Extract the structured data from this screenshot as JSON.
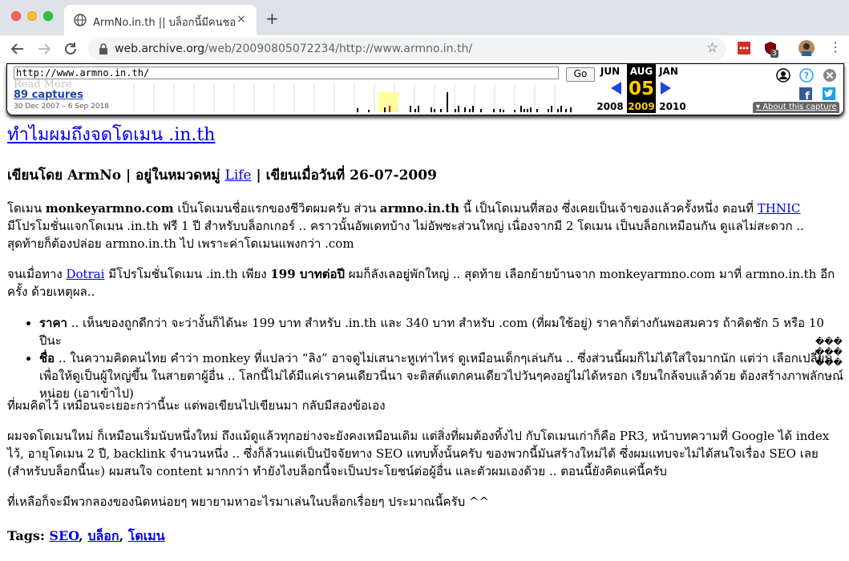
{
  "browser": {
    "tab_title": "ArmNo.in.th || บล็อกนี้มีคนชอบดู",
    "tab_close": "×",
    "new_tab": "+",
    "url_domain": "web.archive.org",
    "url_path": "/web/20090805072234/http://www.armno.in.th/",
    "ext_badge": "3"
  },
  "wayback": {
    "url_value": "http://www.armno.in.th/",
    "go_label": "Go",
    "read_more": "Read More",
    "captures": "89 captures",
    "range": "30 Dec 2007 – 6 Sep 2018",
    "prev_month": "JUN",
    "cur_month": "AUG",
    "next_month": "JAN",
    "cur_day": "05",
    "prev_year": "2008",
    "cur_year": "2009",
    "next_year": "2010",
    "about": "About this capture",
    "sparkline": [
      0,
      0,
      0,
      0,
      0,
      0,
      0,
      0,
      0,
      0,
      0,
      0,
      0,
      0,
      0,
      0,
      0,
      0,
      0,
      0,
      0,
      0,
      0,
      0,
      0,
      0,
      0,
      0,
      0,
      0,
      0,
      0,
      0,
      0,
      0,
      0,
      0,
      0,
      0,
      0,
      0,
      0,
      0,
      0,
      0,
      0,
      0,
      0,
      0,
      0,
      0,
      0,
      0,
      0,
      0,
      0,
      0,
      0,
      0,
      0,
      0,
      0,
      0,
      0,
      0,
      0,
      0,
      0,
      0,
      0,
      0,
      0,
      0,
      0,
      0,
      0,
      0,
      0,
      0,
      0,
      0,
      0,
      0,
      0,
      0,
      0,
      0,
      0,
      0,
      0,
      0,
      0,
      0,
      0,
      0,
      0,
      0,
      0,
      0,
      0,
      0,
      0,
      0,
      0,
      0,
      0,
      0,
      0,
      0,
      0,
      0,
      0,
      0,
      0,
      0,
      0,
      0,
      0,
      0,
      0,
      0,
      0,
      0,
      0,
      0,
      0,
      0,
      0,
      0,
      0,
      0,
      0,
      0,
      0,
      0,
      0,
      0,
      0,
      0,
      0,
      0,
      0,
      0,
      0,
      0,
      0,
      0,
      0,
      0,
      0,
      0,
      0,
      0,
      0,
      0,
      0,
      0,
      0,
      0,
      0,
      0,
      0,
      0,
      0,
      0,
      0,
      0,
      0,
      0,
      0,
      0,
      0,
      0,
      0,
      0,
      0,
      0,
      0,
      0,
      0,
      0,
      0,
      0,
      0,
      0,
      0,
      0,
      0,
      0,
      0,
      0,
      0,
      0,
      0,
      0,
      0,
      0,
      0,
      0,
      0,
      0,
      0,
      0,
      0,
      0,
      0,
      0,
      0,
      0,
      0,
      0,
      0,
      0,
      0,
      0,
      0,
      0,
      0,
      0,
      0,
      0,
      0,
      0,
      0,
      0,
      0,
      0,
      0,
      0,
      0,
      0,
      0,
      0,
      0,
      0,
      0,
      0,
      0,
      0,
      0,
      0,
      0,
      0,
      0,
      0,
      0,
      0,
      0,
      0,
      0,
      0,
      0,
      0,
      0,
      0,
      0,
      0,
      0,
      0,
      0,
      0,
      0,
      0,
      0,
      0,
      0,
      0,
      0,
      0,
      0,
      0,
      0,
      0,
      0,
      0,
      0,
      0,
      0,
      0,
      0,
      0,
      0,
      0,
      0,
      0,
      0,
      0,
      0,
      0,
      0,
      0,
      0,
      0,
      0,
      0,
      0,
      0,
      0,
      0,
      0,
      0,
      0,
      0,
      0,
      0,
      0,
      0,
      0,
      0,
      0,
      0,
      0,
      0,
      0,
      0,
      0,
      0,
      0,
      0,
      0,
      0,
      0,
      0,
      0,
      0,
      0,
      0,
      0,
      0,
      0,
      0,
      0,
      0,
      0,
      0,
      0,
      0,
      0,
      0,
      0,
      0,
      0,
      0,
      0,
      0,
      0,
      0,
      0,
      0,
      0,
      0,
      0,
      0,
      0,
      0,
      0,
      0,
      0,
      0,
      0,
      0,
      0,
      0,
      0,
      0,
      0,
      0,
      0,
      0,
      0,
      0,
      0,
      0,
      0,
      0,
      0,
      0,
      0,
      0,
      0,
      0,
      0,
      0,
      0,
      0,
      0,
      0,
      0,
      0,
      0,
      0,
      0,
      0,
      0,
      0,
      0,
      0,
      0,
      0,
      0,
      0,
      0,
      0,
      0,
      0,
      0,
      0,
      0,
      0,
      0,
      0,
      0,
      0,
      0,
      0,
      0,
      0,
      0,
      0,
      0,
      0,
      0,
      0,
      0,
      0,
      0,
      0,
      0,
      0,
      0,
      0,
      0,
      0,
      0,
      0,
      0,
      0,
      0,
      0,
      0,
      0,
      0,
      0,
      0,
      0,
      0,
      0,
      0,
      0,
      0,
      0,
      0,
      0,
      0,
      0,
      0,
      0,
      0,
      0,
      0,
      0,
      0,
      0,
      0,
      0,
      0,
      0,
      0,
      0,
      0,
      0,
      0,
      0,
      0,
      0,
      0,
      0,
      0,
      0,
      0,
      0,
      0,
      0,
      0,
      0,
      0,
      0,
      0,
      0,
      0,
      0,
      0,
      0,
      0,
      0,
      0,
      0,
      0,
      0,
      0,
      0,
      0,
      0,
      0,
      0,
      0,
      0,
      0,
      0,
      0,
      0,
      0,
      0,
      0,
      0,
      0,
      0,
      0,
      0,
      0,
      0,
      0,
      0,
      0,
      0,
      0,
      0,
      0,
      0,
      0,
      0,
      0,
      0,
      0,
      0,
      0,
      0,
      0,
      0,
      0,
      0,
      0,
      0,
      0,
      0,
      0,
      0,
      0,
      0,
      0,
      0,
      0,
      0,
      0,
      0,
      0,
      0,
      0,
      0,
      0,
      0,
      0,
      0,
      0,
      0,
      0,
      0,
      0,
      0,
      0,
      0,
      0,
      0,
      0,
      0,
      0,
      0,
      0,
      0,
      0,
      0,
      0,
      0,
      0,
      0,
      0,
      0,
      0,
      0,
      0,
      0,
      0,
      0,
      0,
      0,
      0,
      0,
      0,
      0,
      0,
      0,
      0,
      0,
      0,
      0,
      0,
      0,
      0,
      0,
      0,
      0,
      0,
      0,
      0,
      0,
      0,
      0,
      0,
      0,
      0,
      0,
      0,
      0,
      0,
      0,
      0,
      0,
      0,
      0,
      0,
      0,
      0,
      0,
      0,
      0,
      0,
      0,
      0,
      0,
      0,
      0,
      0,
      0,
      0,
      0,
      0,
      0,
      0,
      0,
      0,
      0,
      0,
      0,
      0,
      0,
      0,
      0
    ]
  },
  "page": {
    "headline": "ทำไมผมถึงจดโดเมน .in.th",
    "byline_prefix": "เขียนโดย ArmNo | อยู่ในหมวดหมู่ ",
    "byline_category": "Life",
    "byline_suffix": " | เขียนเมื่อวันที่ 26-07-2009",
    "p1_a": "โดเมน ",
    "p1_b": "monkeyarmno.com",
    "p1_c": " เป็นโดเมนชื่อแรกของชีวิตผมครับ ส่วน ",
    "p1_d": "armno.in.th",
    "p1_e": " นี้ เป็นโดเมนที่สอง ซึ่งเคยเป็นเจ้าของแล้วครั้งหนึ่ง ตอนที่ ",
    "p1_link": "THNIC",
    "p1_f": " มีโปรโมชั่นแจกโดเมน .in.th ฟรี 1 ปี สำหรับบล็อกเกอร์ .. คราวนั้นอัพเดทบ้าง ไม่อัพซะส่วนใหญ่ เนื่องจากมี 2 โดเมน เป็นบล็อกเหมือนกัน ดูแลไม่สะดวก .. สุดท้ายก็ต้องปล่อย armno.in.th ไป เพราะค่าโดเมนแพงกว่า .com",
    "p2_a": "จนเมื่อทาง ",
    "p2_link": "Dotrai",
    "p2_b": " มีโปรโมชั่นโดเมน .in.th เพียง ",
    "p2_c": "199 บาทต่อปี",
    "p2_d": " ผมก็ลังเลอยู่พักใหญ่ .. สุดท้าย เลือกย้ายบ้านจาก monkeyarmno.com มาที่ armno.in.th อีกครั้ง ด้วยเหตุผล..",
    "b1_label": "ราคา",
    "b1_text": " .. เห็นของถูกดีกว่า จะว่างั้นก็ได้นะ 199  บาท สำหรับ .in.th และ 340 บาท สำหรับ .com (ที่ผมใช้อยู่) ราคาก็ต่างกันพอสมควร ถ้าคิดชัก 5 หรือ 10 ปีนะ",
    "b2_label": "ชื่อ",
    "b2_text": " .. ในความคิดคนไทย คำว่า monkey ที่แปลว่า “ลิง” อาจดูไม่เสนาะหูเท่าไหร่ ดูเหมือนเด็กๆเล่นกัน .. ซึ่งส่วนนี้ผมก็ไม่ได้ใส่ใจมากนัก แต่ว่า เลือกเปลี่ยนเพื่อให้ดูเป็นผู้ใหญ่ขึ้น ในสายตาผู้อื่น .. โลกนี้ไม่ได้มีแค่เราคนเดียวนี่นา จะติสต์แตกคนเดียวไปวันๆคงอยู่ไม่ได้หรอก เรียนใกล้จบแล้วด้วย ต้องสร้างภาพลักษณ์หน่อย (เอาเข้าไป)",
    "p3": "ที่ผมคิดไว้ เหมือนจะเยอะกว่านี้นะ แต่พอเขียนไปเขียนมา กลับมีสองข้อเอง",
    "p4": "ผมจดโดเมนใหม่ ก็เหมือนเริ่มนับหนึ่งใหม่ ถึงแม้ดูแล้วทุกอย่างจะยังคงเหมือนเดิม แต่สิ่งที่ผมต้องทิ้งไป กับโดเมนเก่าก็คือ PR3, หน้าบทความที่ Google ได้ index ไว้, อายุโดเมน 2 ปี, backlink จำนวนหนึ่ง .. ซึ่งก็ล้วนแต่เป็นปัจจัยทาง SEO แทบทั้งนั้นครับ ของพวกนี้มันสร้างใหม่ได้ ซึ่งผมแทบจะไม่ได้สนใจเรื่อง SEO เลย (สำหรับบล็อกนี้นะ) ผมสนใจ content มากกว่า ทำยังไงบล็อกนี้จะเป็นประโยชน์ต่อผู้อื่น และตัวผมเองด้วย .. ตอนนี้ยังคิดแค่นี้ครับ",
    "p5": "ที่เหลือก็จะมีพวกลองของนิดหน่อยๆ พยายามหาอะไรมาเล่นในบล็อกเรื่อยๆ ประมาณนี้ครับ ^^",
    "tags_label": "Tags: ",
    "tag1": "SEO",
    "tag2": "บล็อก",
    "tag3": "โดเมน",
    "side_glyphs": "���\n���\n���"
  }
}
